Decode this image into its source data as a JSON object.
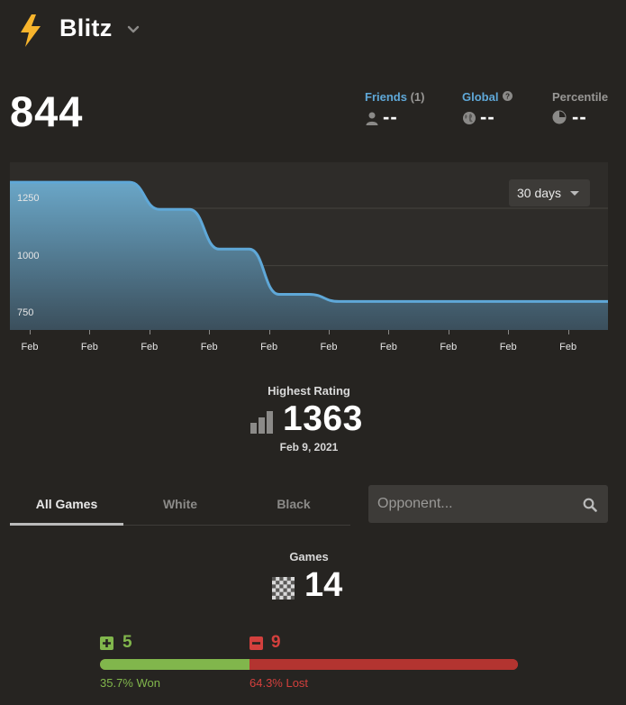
{
  "header": {
    "title": "Blitz",
    "icon": "lightning-bolt-icon",
    "accent": "#f7b42c"
  },
  "rating": "844",
  "rankings": {
    "friends": {
      "label": "Friends",
      "count": "(1)",
      "value": "--",
      "icon": "user-icon"
    },
    "global": {
      "label": "Global",
      "value": "--",
      "icon": "globe-icon",
      "help_icon": "question-icon"
    },
    "percentile": {
      "label": "Percentile",
      "value": "--",
      "icon": "pie-icon"
    }
  },
  "chart_data": {
    "type": "area",
    "range_label": "30 days",
    "y_ticks": [
      750,
      1000,
      1250
    ],
    "x_tick_labels": [
      "Feb",
      "Feb",
      "Feb",
      "Feb",
      "Feb",
      "Feb",
      "Feb",
      "Feb",
      "Feb",
      "Feb"
    ],
    "points": [
      {
        "day": 0,
        "rating": 1363
      },
      {
        "day": 4,
        "rating": 1363
      },
      {
        "day": 5,
        "rating": 1245
      },
      {
        "day": 6,
        "rating": 1245
      },
      {
        "day": 7,
        "rating": 1072
      },
      {
        "day": 8,
        "rating": 1072
      },
      {
        "day": 9,
        "rating": 875
      },
      {
        "day": 10,
        "rating": 875
      },
      {
        "day": 11,
        "rating": 844
      },
      {
        "day": 20,
        "rating": 844
      }
    ],
    "ylim": [
      720,
      1450
    ],
    "grid": true,
    "line_color": "#5fa8d8"
  },
  "highest": {
    "label": "Highest Rating",
    "value": "1363",
    "date": "Feb 9, 2021",
    "icon": "bar-chart-icon"
  },
  "tabs": [
    {
      "label": "All Games",
      "active": true
    },
    {
      "label": "White",
      "active": false
    },
    {
      "label": "Black",
      "active": false
    }
  ],
  "search": {
    "placeholder": "Opponent...",
    "icon": "search-icon"
  },
  "games": {
    "label": "Games",
    "total": "14",
    "icon": "chessboard-icon",
    "won": {
      "count": "5",
      "percent_label": "35.7% Won",
      "fraction": 0.357,
      "color": "#81b64c",
      "icon": "plus-icon"
    },
    "lost": {
      "count": "9",
      "percent_label": "64.3% Lost",
      "fraction": 0.643,
      "color": "#d3403d",
      "icon": "minus-icon"
    }
  }
}
